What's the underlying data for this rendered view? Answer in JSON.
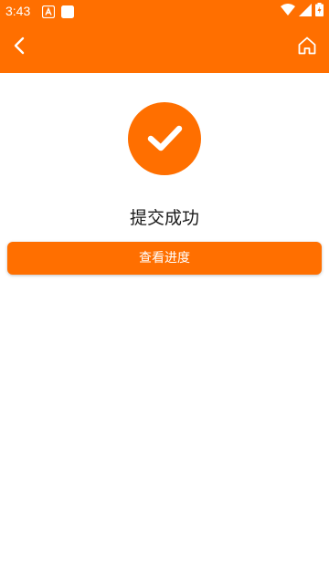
{
  "status_bar": {
    "time": "3:43",
    "left_icons": [
      "android-a-icon",
      "white-square-icon"
    ],
    "right_icons": [
      "wifi-icon",
      "signal-icon",
      "battery-icon"
    ]
  },
  "toolbar": {
    "back_icon": "chevron-left-icon",
    "home_icon": "home-icon"
  },
  "result": {
    "icon": "check-circle-icon",
    "message": "提交成功"
  },
  "actions": {
    "view_progress_label": "查看进度"
  },
  "colors": {
    "accent": "#FF6F00",
    "background": "#FFFFFF",
    "text_primary": "#1A1A1A",
    "text_on_accent": "#FFFFFF"
  }
}
